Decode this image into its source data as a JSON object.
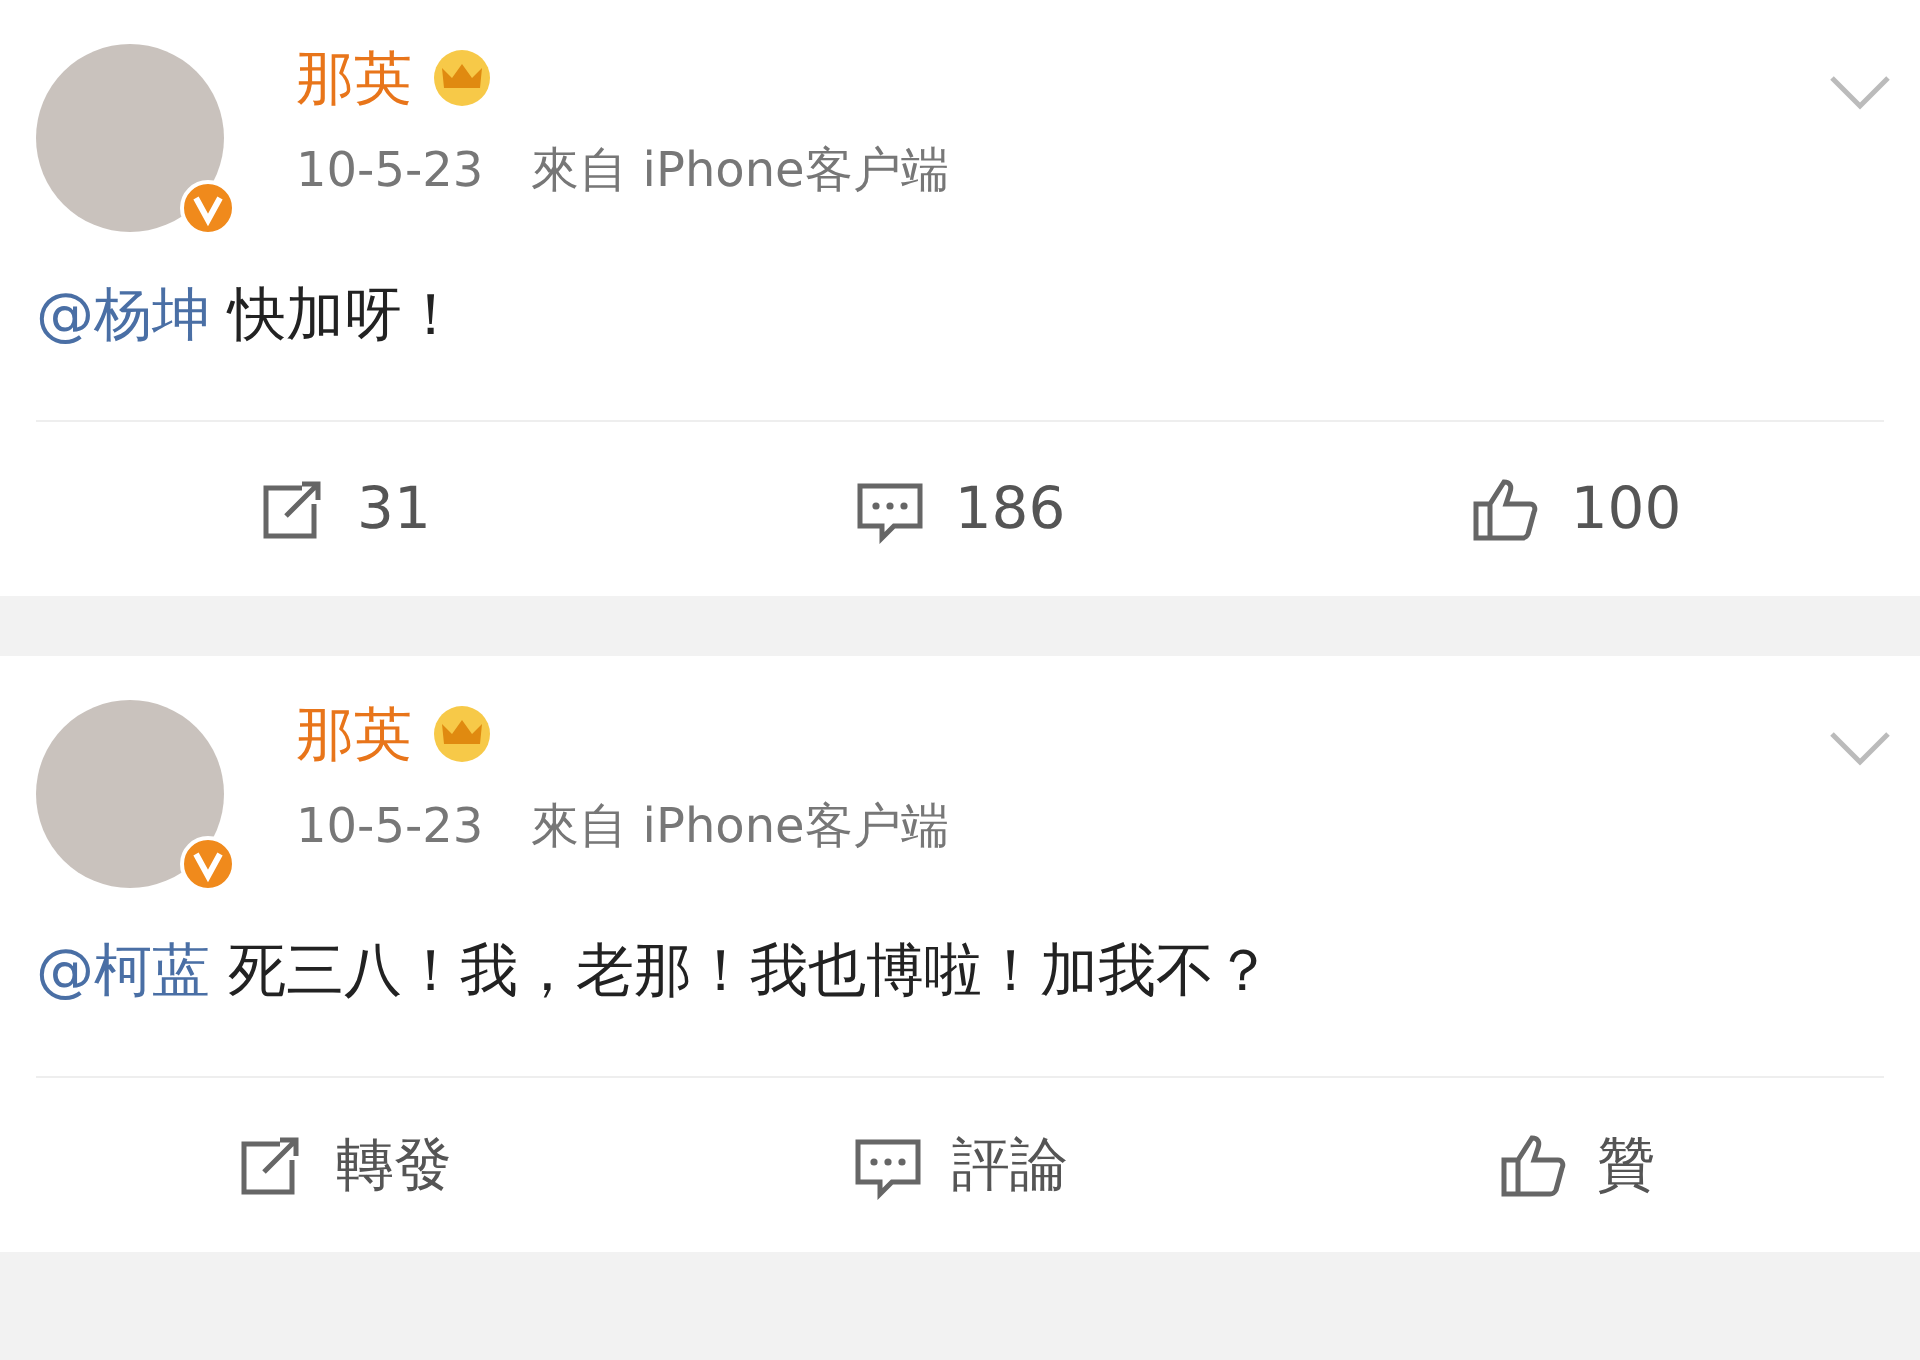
{
  "posts": [
    {
      "author": "那英",
      "date": "10-5-23",
      "source": "來自 iPhone客户端",
      "mention": "@杨坤",
      "text": "快加呀！",
      "actions": [
        {
          "kind": "repost",
          "label": "31"
        },
        {
          "kind": "comment",
          "label": "186"
        },
        {
          "kind": "like",
          "label": "100"
        }
      ]
    },
    {
      "author": "那英",
      "date": "10-5-23",
      "source": "來自 iPhone客户端",
      "mention": "@柯蓝",
      "text": "死三八！我，老那！我也博啦！加我不？",
      "actions": [
        {
          "kind": "repost",
          "label": "轉發"
        },
        {
          "kind": "comment",
          "label": "評論"
        },
        {
          "kind": "like",
          "label": "贊"
        }
      ]
    }
  ]
}
